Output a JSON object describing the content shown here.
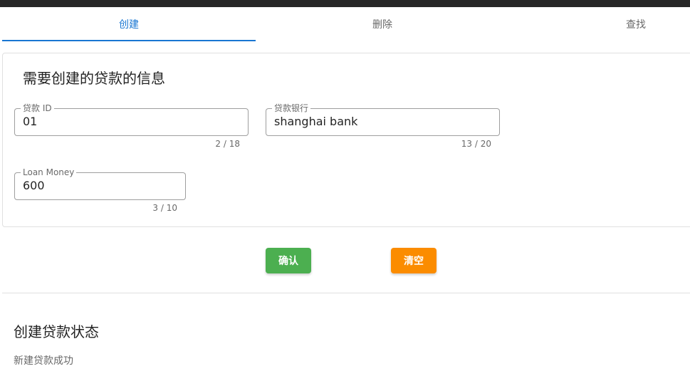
{
  "tabs": [
    {
      "label": "创建",
      "active": true
    },
    {
      "label": "删除",
      "active": false
    },
    {
      "label": "查找",
      "active": false
    }
  ],
  "form": {
    "title": "需要创建的贷款的信息",
    "fields": [
      {
        "label": "贷款 ID",
        "value": "01",
        "counter": "2 / 18"
      },
      {
        "label": "贷款银行",
        "value": "shanghai bank",
        "counter": "13 / 20"
      },
      {
        "label": "Loan Money",
        "value": "600",
        "counter": "3 / 10"
      }
    ]
  },
  "actions": {
    "confirm_label": "确认",
    "clear_label": "清空"
  },
  "status": {
    "title": "创建贷款状态",
    "message": "新建贷款成功"
  },
  "colors": {
    "primary": "#1976d2",
    "confirm": "#4caf50",
    "clear": "#fb8c00",
    "topbar": "#272727"
  }
}
